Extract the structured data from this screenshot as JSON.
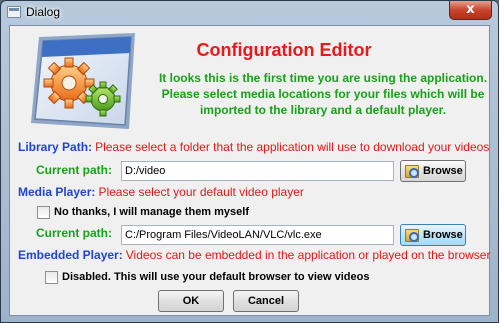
{
  "window": {
    "title": "Dialog",
    "close_glyph": "x"
  },
  "header": {
    "heading": "Configuration Editor",
    "intro": "It looks this is the first time you are using the application. Please select media locations for your files which will be imported to the library and a default player."
  },
  "library": {
    "label": "Library Path:",
    "description": "Please select a folder that the application will use to download your videos",
    "path_label": "Current path:",
    "path_value": "D:/video",
    "browse_label": "Browse"
  },
  "player": {
    "label": "Media Player:",
    "description": "Please select your default video player",
    "checkbox_label": "No thanks, I will manage them myself",
    "checkbox_checked": false,
    "path_label": "Current path:",
    "path_value": "C:/Program Files/VideoLAN/VLC/vlc.exe",
    "browse_label": "Browse"
  },
  "embedded": {
    "label": "Embedded Player:",
    "description": "Videos can be embedded in the application or played on the browser",
    "checkbox_label": "Disabled. This will use your default browser to view videos",
    "checkbox_checked": false
  },
  "footer": {
    "ok_label": "OK",
    "cancel_label": "Cancel"
  },
  "icons": {
    "title": "window-icon",
    "logo": "gears-logo",
    "browse": "folder-search-icon"
  },
  "colors": {
    "heading": "#e81a1a",
    "intro": "#1aa01a",
    "section_label": "#1f44d6",
    "section_description": "#e01818",
    "sub_label": "#1aa01a"
  }
}
